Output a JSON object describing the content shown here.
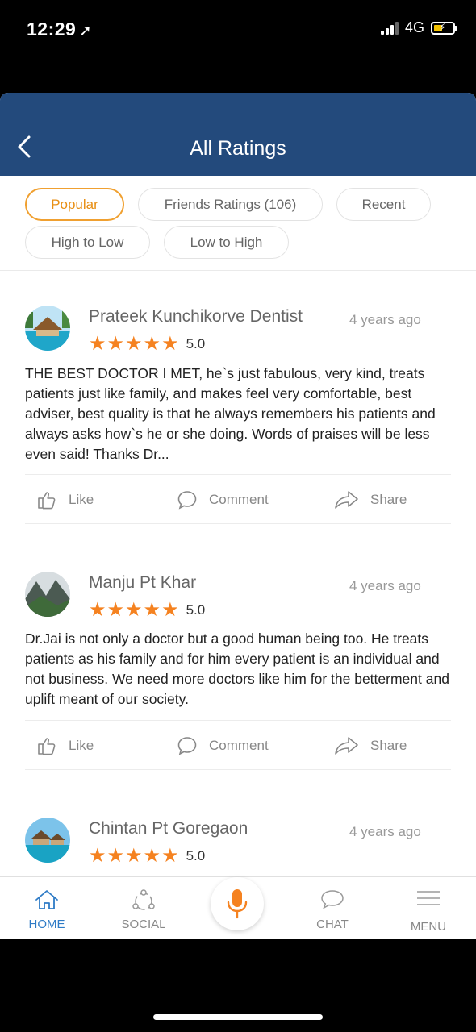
{
  "status_bar": {
    "time": "12:29",
    "location_glyph": "➚",
    "network": "4G",
    "battery_color": "#f2c200"
  },
  "header": {
    "title": "All Ratings",
    "back_icon": "chevron-left-icon",
    "background": "#234a7c"
  },
  "filters": [
    {
      "label": "Popular",
      "active": true
    },
    {
      "label": "Friends Ratings (106)",
      "active": false
    },
    {
      "label": "Recent",
      "active": false
    },
    {
      "label": "High to Low",
      "active": false
    },
    {
      "label": "Low to High",
      "active": false
    }
  ],
  "reviews": [
    {
      "name": "Prateek Kunchikorve Dentist",
      "time": "4 years ago",
      "stars": 5,
      "rating": "5.0",
      "text": "THE BEST DOCTOR I MET, he`s just fabulous, very kind, treats patients just like family, and makes feel very comfortable, best adviser, best quality is that he always remembers his patients and always asks how`s he or she doing. Words of praises will be less even said!  Thanks Dr...",
      "like": "Like",
      "comment": "Comment",
      "share": "Share"
    },
    {
      "name": "Manju Pt Khar",
      "time": "4 years ago",
      "stars": 5,
      "rating": "5.0",
      "text": "Dr.Jai is not only a doctor but a good human being too. He treats patients as his family and for him every patient is an individual and not business. We need more doctors like him for the betterment and uplift meant of our society.",
      "like": "Like",
      "comment": "Comment",
      "share": "Share"
    },
    {
      "name": "Chintan Pt Goregaon",
      "time": "4 years ago",
      "stars": 5,
      "rating": "5.0"
    }
  ],
  "bottom_nav": {
    "home": "HOME",
    "social": "SOCIAL",
    "chat": "CHAT",
    "menu": "MENU",
    "active_color": "#2e7bc6",
    "mic_color": "#f58220"
  },
  "accent": "#f58220"
}
